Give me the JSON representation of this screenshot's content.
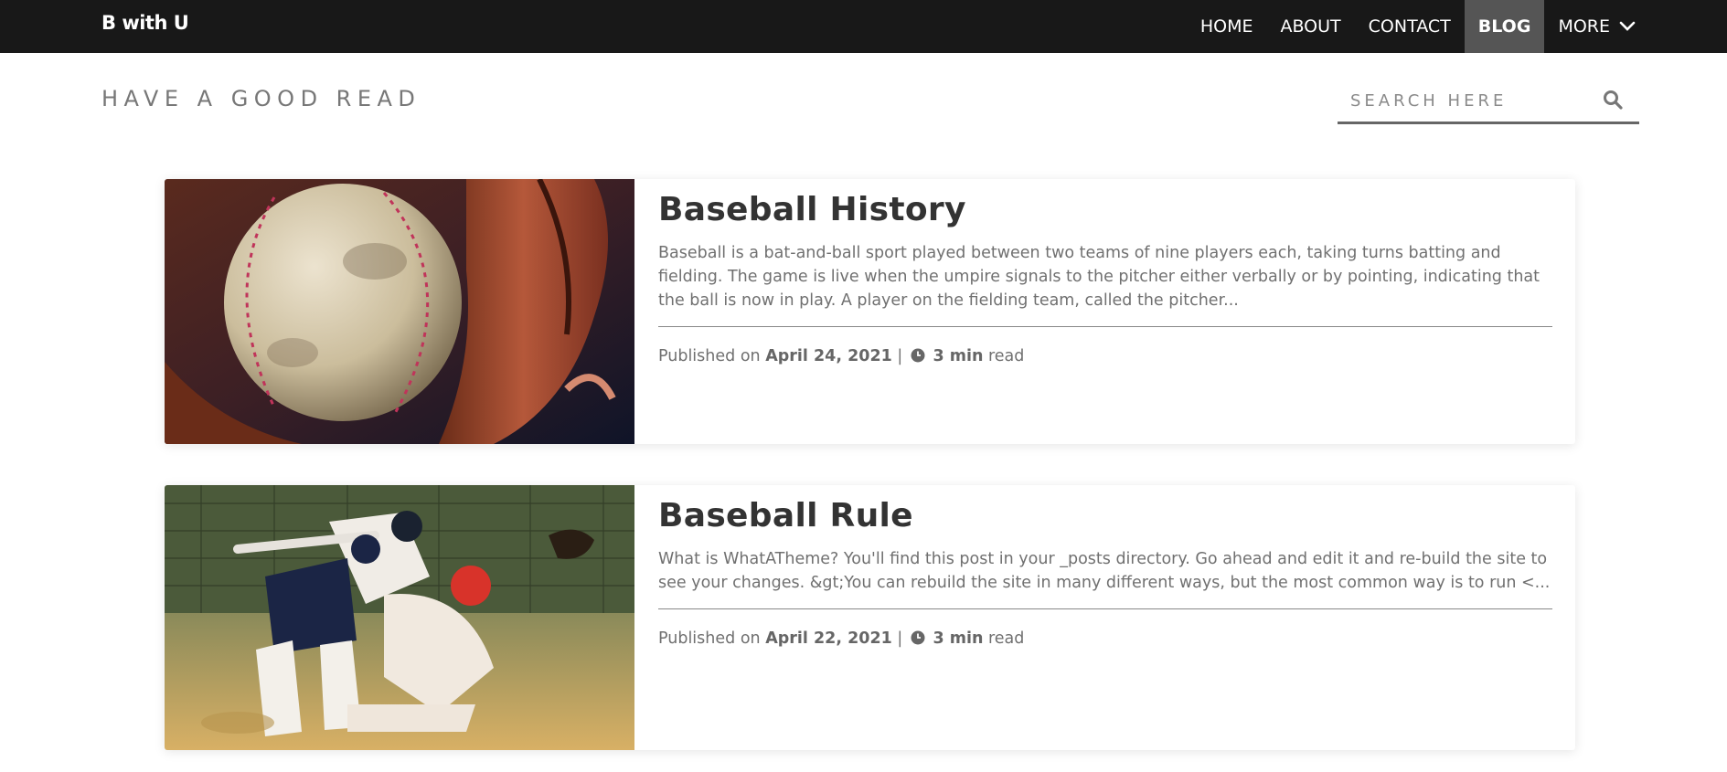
{
  "navbar": {
    "brand": "B with U",
    "links": [
      {
        "label": "HOME",
        "active": false
      },
      {
        "label": "ABOUT",
        "active": false
      },
      {
        "label": "CONTACT",
        "active": false
      },
      {
        "label": "BLOG",
        "active": true
      },
      {
        "label": "MORE",
        "active": false
      }
    ],
    "more_icon": "chevron-down-icon"
  },
  "header": {
    "tagline": "HAVE A GOOD READ",
    "search": {
      "placeholder": "SEARCH HERE",
      "value": "",
      "icon": "search-icon"
    }
  },
  "posts": [
    {
      "title": "Baseball History",
      "excerpt": "Baseball is a bat-and-ball sport played between two teams of nine players each, taking turns batting and fielding. The game is live when the umpire signals to the pitcher either verbally or by pointing, indicating that the ball is now in play. A player on the fielding team, called the pitcher...",
      "published_prefix": "Published on",
      "date": "April 24, 2021",
      "separator": "|",
      "read_time": "3 min",
      "read_suffix": "read",
      "image": "baseball-in-glove"
    },
    {
      "title": "Baseball Rule",
      "excerpt": "What is WhatATheme? You'll find this post in your _posts directory. Go ahead and edit it and re-build the site to see your changes. &gt;You can rebuild the site in many different ways, but the most common way is to run <...",
      "published_prefix": "Published on",
      "date": "April 22, 2021",
      "separator": "|",
      "read_time": "3 min",
      "read_suffix": "read",
      "image": "player-sliding-into-base"
    }
  ],
  "colors": {
    "navbar_bg": "#181818",
    "nav_active_bg": "#555555",
    "tagline": "#777777",
    "body_text": "#707070",
    "title_text": "#333333"
  }
}
